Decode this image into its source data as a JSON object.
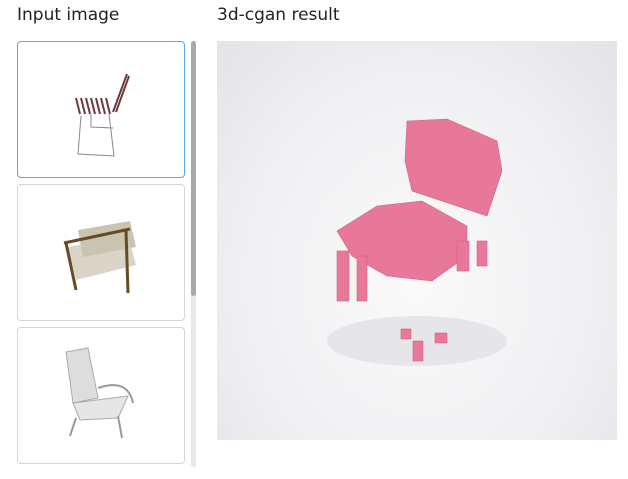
{
  "headers": {
    "input": "Input image",
    "result": "3d-cgan result"
  },
  "colors": {
    "voxel": "#e8789a",
    "selected_border": "#5aa6e8"
  }
}
